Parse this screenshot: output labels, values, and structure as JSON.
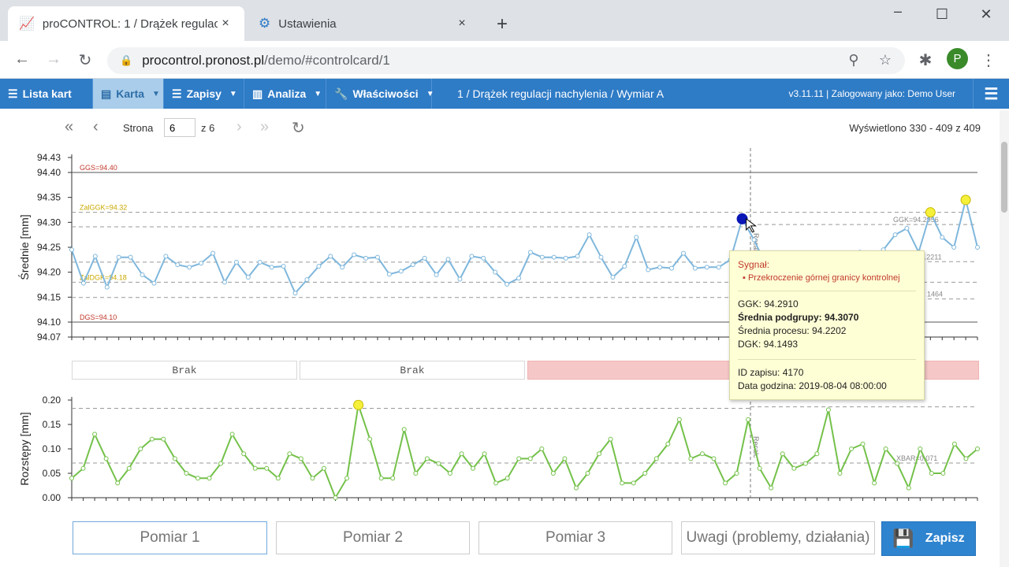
{
  "browser": {
    "tabs": [
      {
        "title": "proCONTROL: 1 / Drążek regulacji nachylenia",
        "icon": "chart-icon",
        "close": "×"
      },
      {
        "title": "Ustawienia",
        "icon": "gear-icon",
        "close": "×"
      }
    ],
    "new_tab": "+",
    "url_host": "procontrol.pronost.pl",
    "url_path": "/demo/#controlcard/1",
    "profile_initial": "P"
  },
  "menu": {
    "items": [
      {
        "label": "Lista kart",
        "icon": "list-icon"
      },
      {
        "label": "Karta",
        "icon": "card-icon"
      },
      {
        "label": "Zapisy",
        "icon": "list-icon"
      },
      {
        "label": "Analiza",
        "icon": "analysis-icon"
      },
      {
        "label": "Właściwości",
        "icon": "wrench-icon"
      }
    ],
    "title": "1 / Drążek regulacji nachylenia / Wymiar A",
    "version": "v3.11.11 | Zalogowany jako: Demo User"
  },
  "pager": {
    "label": "Strona",
    "page": "6",
    "of": "z 6",
    "count": "Wyświetlono 330 - 409 z 409"
  },
  "chart_data": [
    {
      "type": "line",
      "ylabel": "Średnie [mm]",
      "ylim": [
        94.07,
        94.43
      ],
      "yticks": [
        "94.43",
        "94.40",
        "94.35",
        "94.30",
        "94.25",
        "94.20",
        "94.15",
        "94.10",
        "94.07"
      ],
      "limit_labels": [
        "GGS=94.40",
        "ZalGGK=94.32",
        "ZalDGK=94.18",
        "DGS=94.10",
        "GGK=94.2956",
        "XBAR=94.2211",
        "1464",
        "Recalc"
      ],
      "values": [
        94.245,
        94.178,
        94.232,
        94.17,
        94.23,
        94.23,
        94.195,
        94.178,
        94.232,
        94.215,
        94.21,
        94.218,
        94.238,
        94.18,
        94.22,
        94.19,
        94.22,
        94.21,
        94.212,
        94.158,
        94.185,
        94.212,
        94.232,
        94.21,
        94.235,
        94.228,
        94.23,
        94.196,
        94.202,
        94.215,
        94.228,
        94.195,
        94.226,
        94.186,
        94.232,
        94.228,
        94.2,
        94.176,
        94.188,
        94.24,
        94.23,
        94.23,
        94.228,
        94.232,
        94.275,
        94.23,
        94.19,
        94.212,
        94.27,
        94.205,
        94.21,
        94.208,
        94.238,
        94.208,
        94.21,
        94.21,
        94.225,
        94.307,
        94.265,
        94.215,
        94.19,
        94.23,
        94.2,
        94.205,
        94.21,
        94.215,
        94.21,
        94.24,
        94.23,
        94.245,
        94.275,
        94.288,
        94.24,
        94.32,
        94.27,
        94.25,
        94.345,
        94.25
      ],
      "highlight": {
        "index": 57,
        "value": 94.307,
        "color": "#0a16b5"
      },
      "signals": [
        {
          "index": 73,
          "value": 94.32
        },
        {
          "index": 76,
          "value": 94.345
        }
      ]
    },
    {
      "type": "line",
      "ylabel": "Rozstępy [mm]",
      "ylim": [
        0,
        0.2
      ],
      "yticks": [
        "0.20",
        "0.15",
        "0.10",
        "0.05",
        "0.00"
      ],
      "limit_labels": [
        "XBAR=0.071",
        "Recalc"
      ],
      "values": [
        0.04,
        0.06,
        0.13,
        0.08,
        0.03,
        0.06,
        0.1,
        0.12,
        0.12,
        0.08,
        0.05,
        0.04,
        0.04,
        0.07,
        0.13,
        0.09,
        0.06,
        0.06,
        0.04,
        0.09,
        0.08,
        0.04,
        0.06,
        0.0,
        0.04,
        0.19,
        0.12,
        0.04,
        0.04,
        0.14,
        0.05,
        0.08,
        0.07,
        0.05,
        0.09,
        0.06,
        0.09,
        0.03,
        0.04,
        0.08,
        0.08,
        0.1,
        0.05,
        0.08,
        0.02,
        0.05,
        0.09,
        0.12,
        0.03,
        0.03,
        0.05,
        0.08,
        0.11,
        0.16,
        0.08,
        0.09,
        0.08,
        0.03,
        0.05,
        0.16,
        0.06,
        0.02,
        0.09,
        0.06,
        0.07,
        0.09,
        0.18,
        0.05,
        0.1,
        0.11,
        0.03,
        0.1,
        0.07,
        0.02,
        0.1,
        0.05,
        0.05,
        0.11,
        0.08,
        0.1
      ],
      "signals": [
        {
          "index": 25,
          "value": 0.19
        }
      ]
    }
  ],
  "rules": [
    "Brak",
    "Brak",
    "Pp = 1"
  ],
  "tooltip": {
    "title": "Sygnał:",
    "item": "Przekroczenie górnej granicy kontrolnej",
    "ggk": "GGK: 94.2910",
    "mean": "Średnia podgrupy: 94.3070",
    "process": "Średnia procesu: 94.2202",
    "dgk": "DGK: 94.1493",
    "id": "ID zapisu: 4170",
    "date": "Data godzina: 2019-08-04 08:00:00"
  },
  "inputs": [
    {
      "placeholder": "Pomiar 1"
    },
    {
      "placeholder": "Pomiar 2"
    },
    {
      "placeholder": "Pomiar 3"
    },
    {
      "placeholder": "Uwagi (problemy, działania)"
    }
  ],
  "save_label": "Zapisz",
  "colors": {
    "accent": "#2e7bc6",
    "mean_line": "#7fb7dc",
    "range_line": "#74c14a",
    "alert": "#f6c7c7",
    "signal": "#f5f03a"
  }
}
